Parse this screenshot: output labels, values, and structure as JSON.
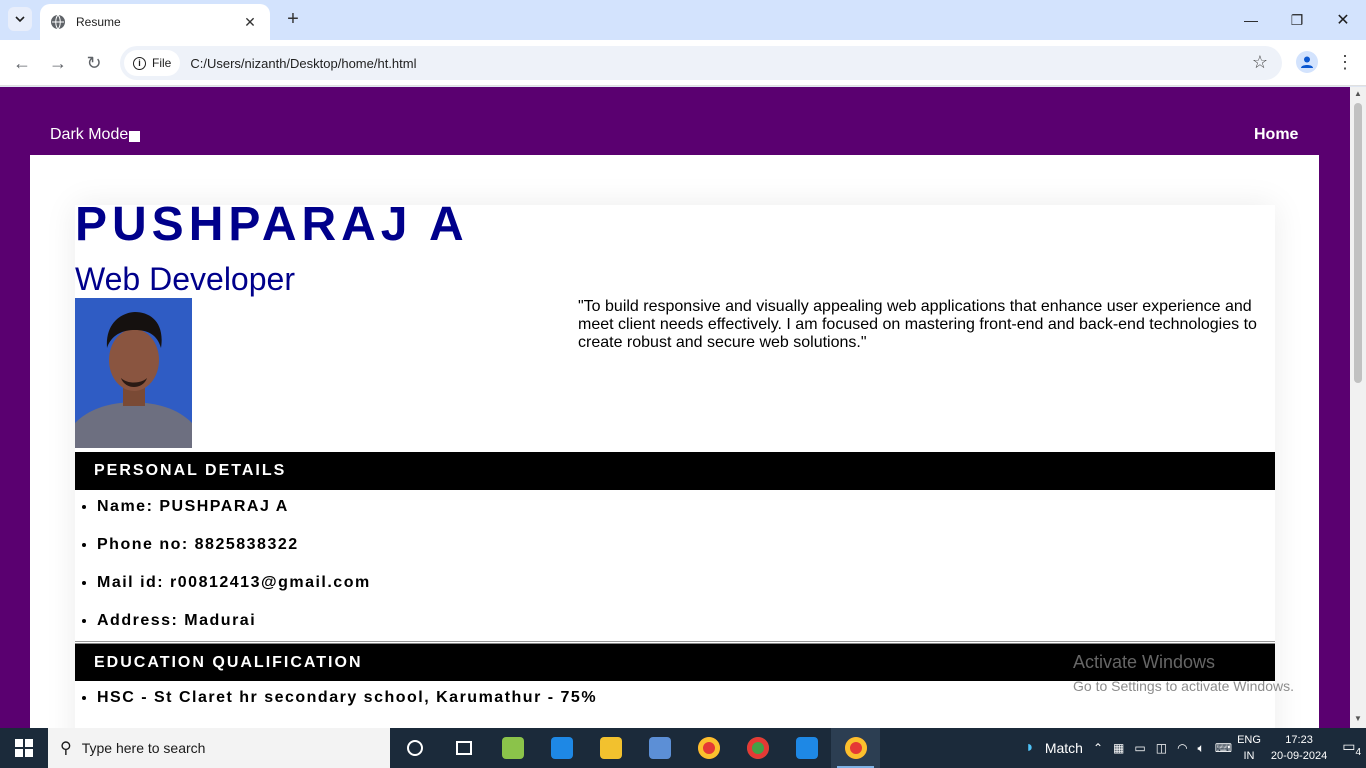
{
  "browser": {
    "tab_title": "Resume",
    "site_chip": "File",
    "url": "C:/Users/nizanth/Desktop/home/ht.html"
  },
  "page": {
    "dark_mode_label": "Dark Mode",
    "home_link": "Home",
    "name": "PUSHPARAJ A",
    "role": "Web Developer",
    "objective": "\"To build responsive and visually appealing web applications that enhance user experience and meet client needs effectively. I am focused on mastering front-end and back-end technologies to create robust and secure web solutions.\"",
    "sections": {
      "personal": {
        "heading": "PERSONAL DETAILS",
        "items": [
          "Name: PUSHPARAJ A",
          "Phone no: 8825838322",
          "Mail id: r00812413@gmail.com",
          "Address: Madurai"
        ]
      },
      "education": {
        "heading": "EDUCATION QUALIFICATION",
        "items": [
          "HSC - St Claret hr secondary school, Karumathur - 75%"
        ]
      }
    },
    "colors": {
      "page_bg": "#5a0070",
      "heading_blue": "#00008b",
      "section_bar": "#000000"
    }
  },
  "watermark": {
    "line1": "Activate Windows",
    "line2": "Go to Settings to activate Windows."
  },
  "taskbar": {
    "search_placeholder": "Type here to search",
    "weather": "Match",
    "lang_top": "ENG",
    "lang_bottom": "IN",
    "time": "17:23",
    "date": "20-09-2024",
    "notification_count": "4"
  }
}
